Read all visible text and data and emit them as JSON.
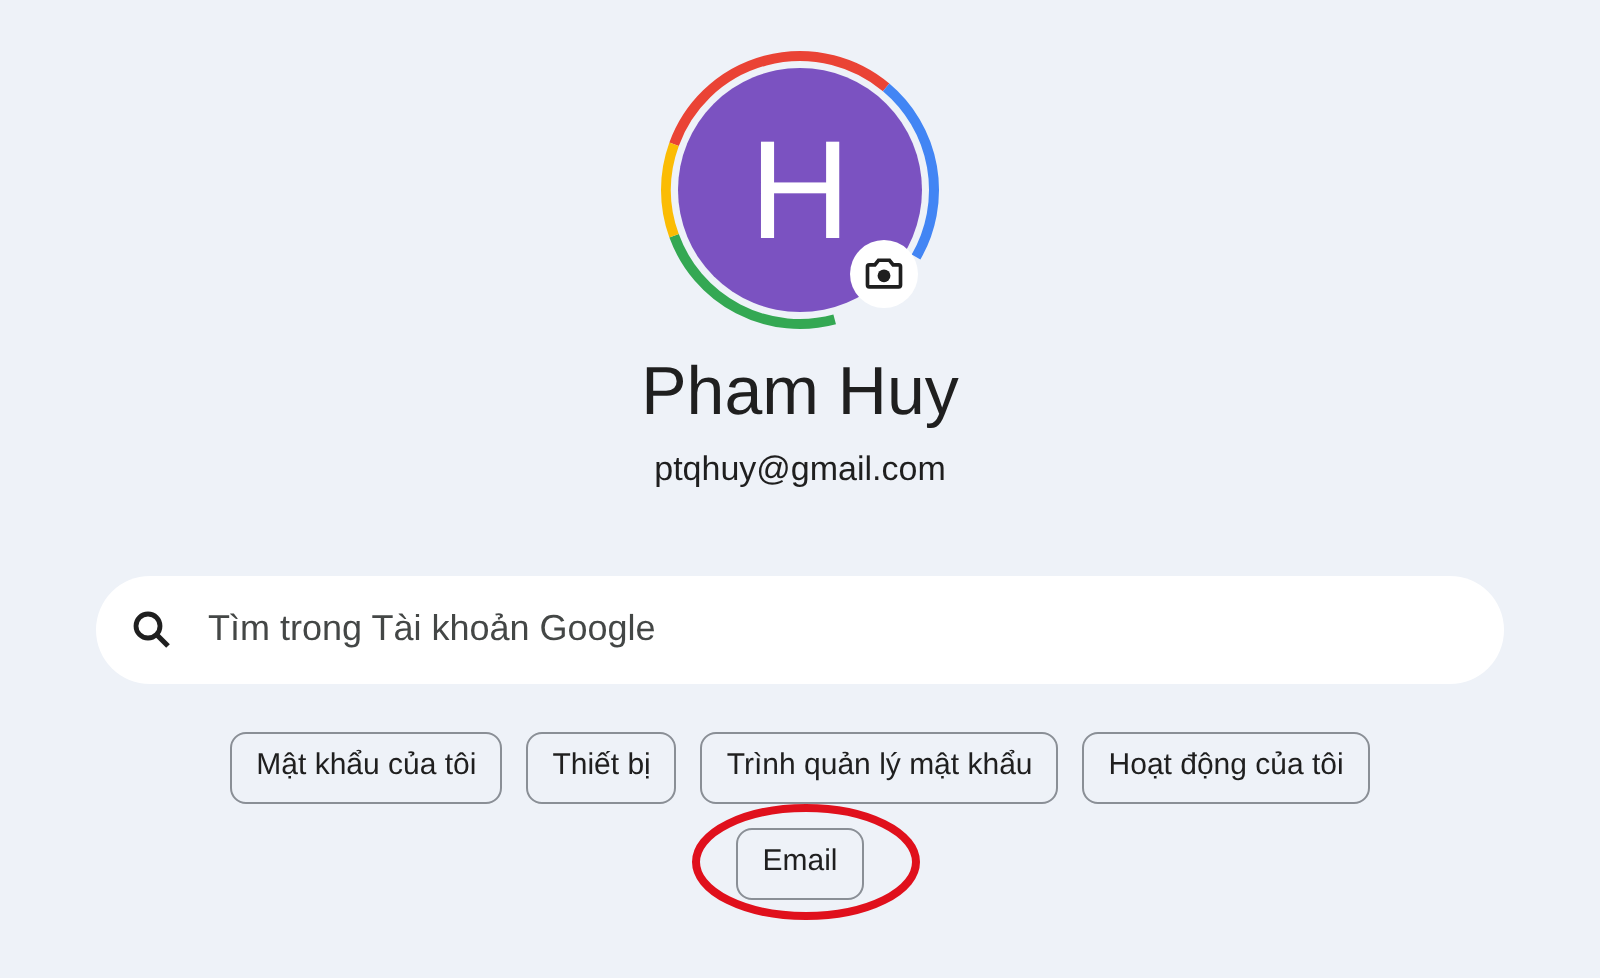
{
  "profile": {
    "initial": "H",
    "name": "Pham Huy",
    "email": "ptqhuy@gmail.com"
  },
  "search": {
    "placeholder": "Tìm trong Tài khoản Google"
  },
  "chips": [
    {
      "label": "Mật khẩu của tôi",
      "highlighted": false
    },
    {
      "label": "Thiết bị",
      "highlighted": false
    },
    {
      "label": "Trình quản lý mật khẩu",
      "highlighted": false
    },
    {
      "label": "Hoạt động của tôi",
      "highlighted": false
    },
    {
      "label": "Email",
      "highlighted": true
    }
  ]
}
